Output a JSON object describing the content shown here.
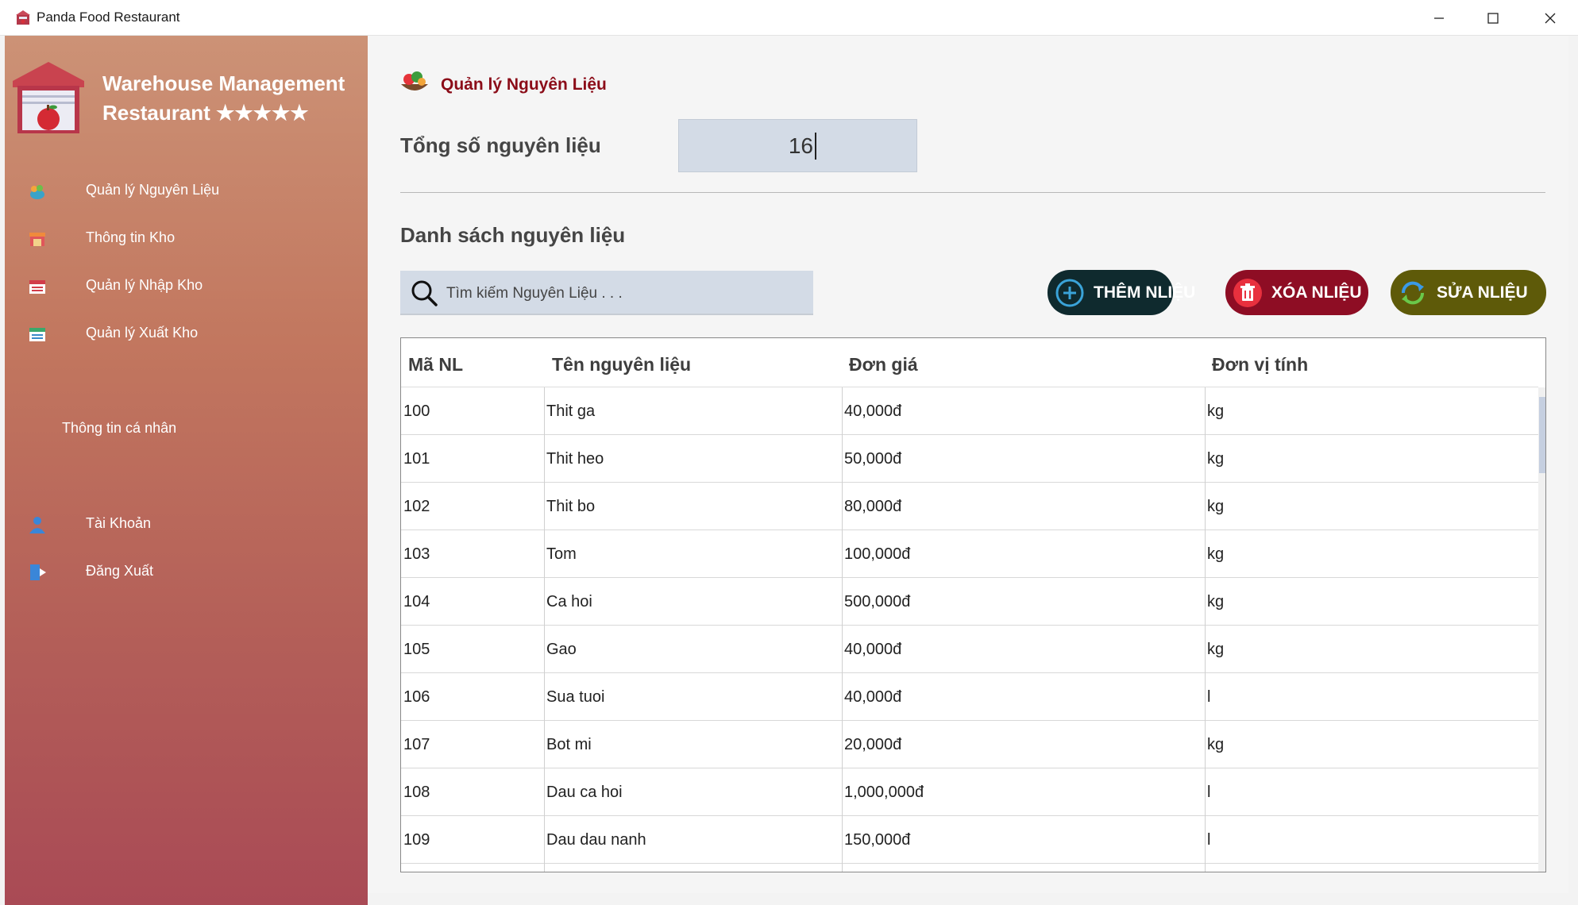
{
  "window": {
    "title": "Panda Food Restaurant"
  },
  "sidebar": {
    "brand": {
      "line1": "Warehouse Management",
      "line2": "Restaurant ★★★★★"
    },
    "items": [
      {
        "label": "Quản lý Nguyên Liệu",
        "icon": "vegetables-icon"
      },
      {
        "label": "Thông tin Kho",
        "icon": "store-icon"
      },
      {
        "label": "Quản lý Nhập Kho",
        "icon": "import-warehouse-icon"
      },
      {
        "label": "Quản lý Xuất Kho",
        "icon": "export-warehouse-icon"
      }
    ],
    "section_label": "Thông tin cá nhân",
    "account_items": [
      {
        "label": "Tài Khoản",
        "icon": "user-icon"
      },
      {
        "label": "Đăng Xuất",
        "icon": "logout-icon"
      }
    ]
  },
  "main": {
    "page_title": "Quản lý Nguyên Liệu",
    "total_label": "Tổng số nguyên liệu",
    "total_value": "16",
    "list_label": "Danh sách nguyên liệu",
    "search_placeholder": "Tìm kiếm Nguyên Liệu . . .",
    "buttons": {
      "add": "THÊM NLIỆU",
      "delete": "XÓA NLIỆU",
      "edit": "SỬA NLIỆU"
    },
    "table": {
      "columns": [
        "Mã NL",
        "Tên nguyên liệu",
        "Đơn giá",
        "Đơn vị tính"
      ],
      "rows": [
        [
          "100",
          "Thit ga",
          "40,000đ",
          "kg"
        ],
        [
          "101",
          "Thit heo",
          "50,000đ",
          "kg"
        ],
        [
          "102",
          "Thit bo",
          "80,000đ",
          "kg"
        ],
        [
          "103",
          "Tom",
          "100,000đ",
          "kg"
        ],
        [
          "104",
          "Ca hoi",
          "500,000đ",
          "kg"
        ],
        [
          "105",
          "Gao",
          "40,000đ",
          "kg"
        ],
        [
          "106",
          "Sua tuoi",
          "40,000đ",
          "l"
        ],
        [
          "107",
          "Bot mi",
          "20,000đ",
          "kg"
        ],
        [
          "108",
          "Dau ca hoi",
          "1,000,000đ",
          "l"
        ],
        [
          "109",
          "Dau dau nanh",
          "150,000đ",
          "l"
        ]
      ]
    }
  },
  "colors": {
    "sidebar_top": "#cc9276",
    "sidebar_bottom": "#a94a55",
    "title_red": "#8b0c18",
    "btn_add": "#0f2a2e",
    "btn_delete": "#8e0d24",
    "btn_edit": "#5e5a09"
  }
}
